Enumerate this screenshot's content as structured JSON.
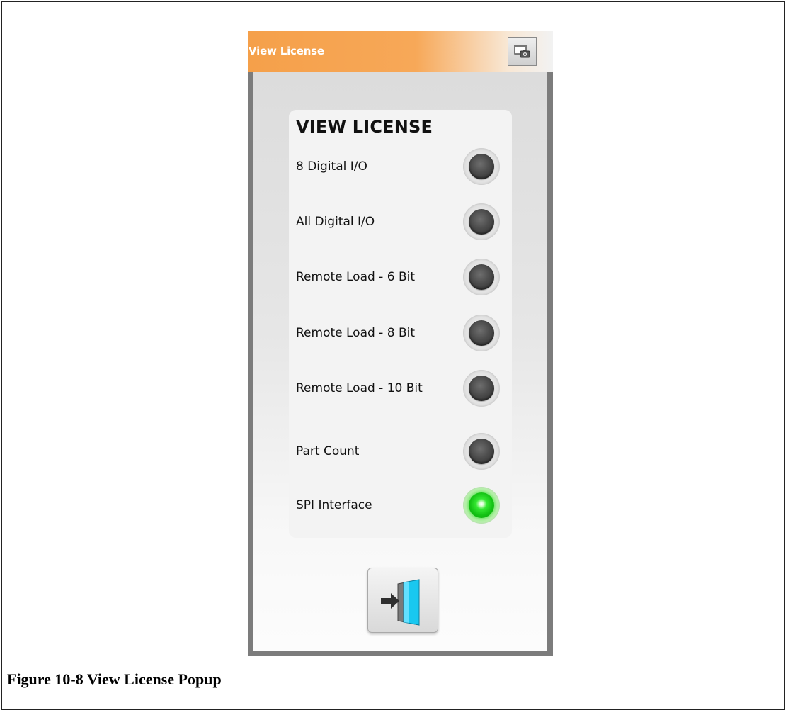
{
  "window": {
    "title": "View License",
    "title_color": "#ffffff",
    "titlebar_accent": "#f5a04a",
    "snapshot_icon": "screen-capture-icon"
  },
  "panel": {
    "heading": "VIEW LICENSE",
    "licenses": [
      {
        "label": "8 Digital I/O",
        "active": false
      },
      {
        "label": "All Digital I/O",
        "active": false
      },
      {
        "label": "Remote Load - 6 Bit",
        "active": false
      },
      {
        "label": "Remote Load - 8 Bit",
        "active": false
      },
      {
        "label": "Remote Load - 10 Bit",
        "active": false
      },
      {
        "label": "Part Count",
        "active": false
      },
      {
        "label": "SPI Interface",
        "active": true
      }
    ],
    "led_on_color": "#14c214",
    "led_off_color": "#4c4c4c"
  },
  "footer": {
    "exit_icon": "exit-door-icon"
  },
  "caption": "Figure 10-8 View License Popup"
}
